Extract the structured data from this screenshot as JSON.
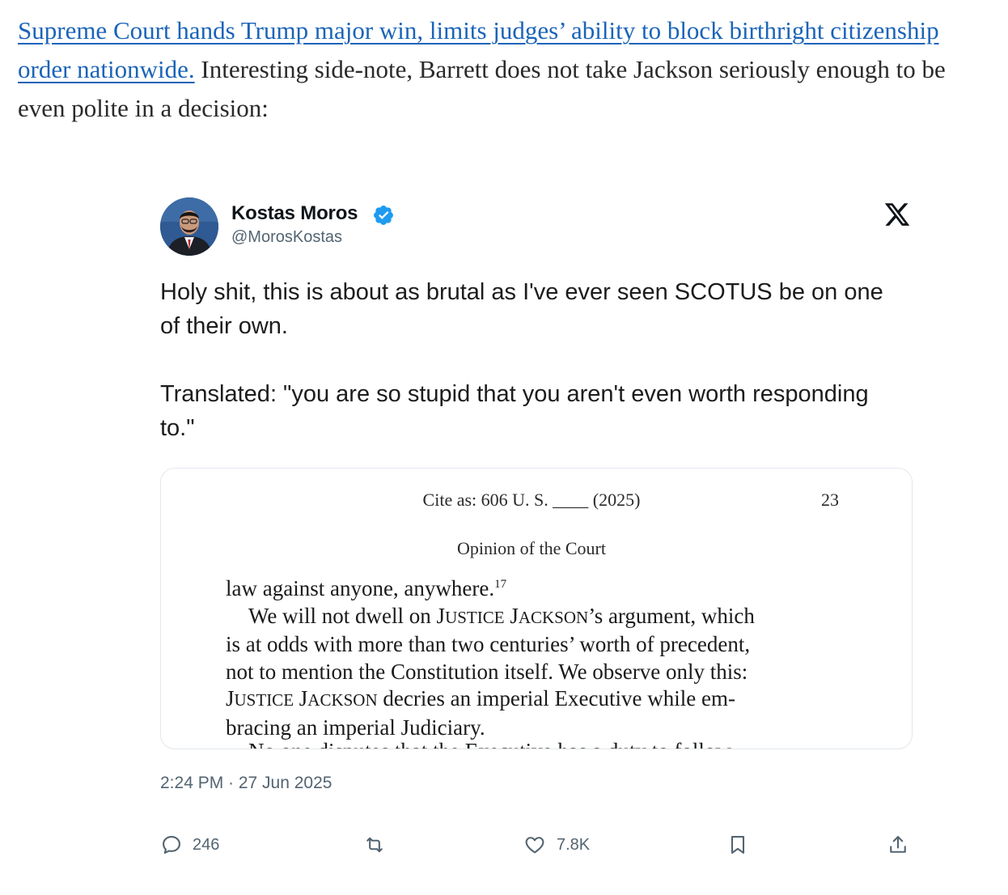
{
  "article": {
    "link_text": "Supreme Court hands Trump major win, limits judges’ ability to block birthright citizenship order nationwide.",
    "body_text": "Interesting side-note, Barrett does not take Jackson seriously enough to be even polite in a decision:"
  },
  "tweet": {
    "author_name": "Kostas Moros",
    "author_handle": "@MorosKostas",
    "paragraphs": [
      "Holy shit, this is about as brutal as I've ever seen SCOTUS be on one of their own.",
      "Translated: \"you are so stupid that you aren't even worth responding to.\""
    ],
    "timestamp": "2:24 PM · 27 Jun 2025",
    "stats": {
      "replies": "246",
      "likes": "7.8K"
    },
    "icons": {
      "verified": "verified-badge-icon",
      "platform": "x-logo-icon",
      "reply": "reply-icon",
      "retweet": "retweet-icon",
      "like": "heart-icon",
      "bookmark": "bookmark-icon",
      "share": "share-icon"
    },
    "colors": {
      "link": "#1a64b8",
      "verified": "#1d9bf0",
      "secondary_text": "#536471"
    }
  },
  "document": {
    "cite": "Cite as:  606 U. S. ____ (2025)",
    "page_number": "23",
    "heading": "Opinion of the Court",
    "line1": "law against anyone, anywhere.",
    "footnote": "17",
    "line2": "We will not dwell on",
    "jackson_j": "J",
    "jackson_ustice": "USTICE",
    "jackson_j2": "J",
    "jackson_ackson": "ACKSON",
    "line2_tail": "’s argument, which",
    "line3": "is at odds with more than two centuries’ worth of precedent,",
    "line4": "not to mention the Constitution itself.  We observe only this:",
    "line5_tail": " decries an imperial Executive while em-",
    "line6": "bracing an imperial Judiciary.",
    "line7_cut": "No one disputes that the Executive has a duty to follow"
  }
}
